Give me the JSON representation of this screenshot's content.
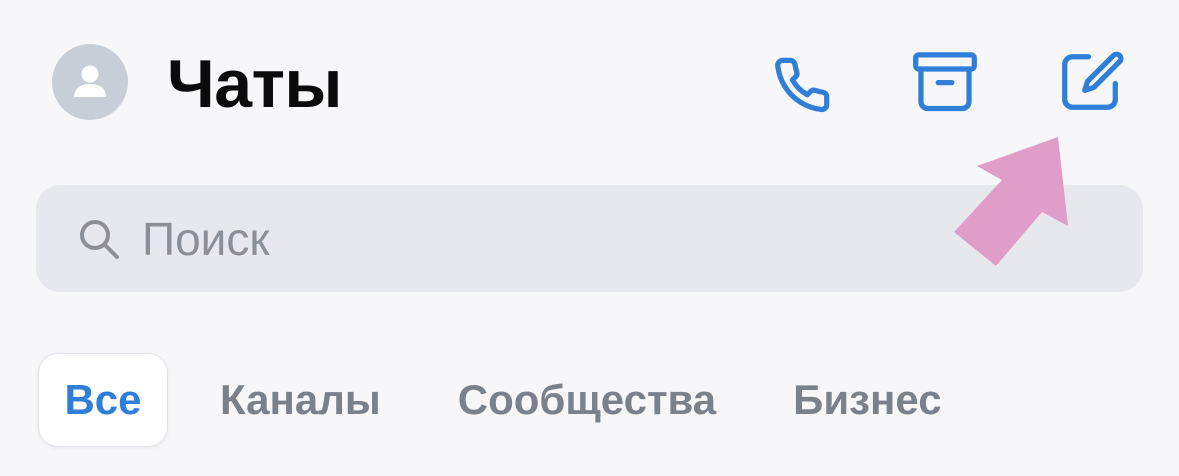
{
  "header": {
    "title": "Чаты",
    "avatar_icon": "user-silhouette-icon",
    "actions": [
      {
        "name": "call",
        "icon": "phone-icon"
      },
      {
        "name": "archive",
        "icon": "archive-box-icon"
      },
      {
        "name": "compose",
        "icon": "compose-pencil-icon"
      }
    ]
  },
  "search": {
    "placeholder": "Поиск",
    "value": "",
    "icon": "search-icon"
  },
  "tabs": [
    {
      "label": "Все",
      "active": true
    },
    {
      "label": "Каналы",
      "active": false
    },
    {
      "label": "Сообщества",
      "active": false
    },
    {
      "label": "Бизнес",
      "active": false
    }
  ],
  "overlay": {
    "icon": "pointer-arrow-icon",
    "color": "#df9dc7"
  },
  "colors": {
    "accent": "#2f7ed8",
    "background": "#f7f7f9",
    "search_background": "#e7e8ed",
    "inactive_tab": "#7b818b",
    "avatar_background": "#c7ced8"
  }
}
